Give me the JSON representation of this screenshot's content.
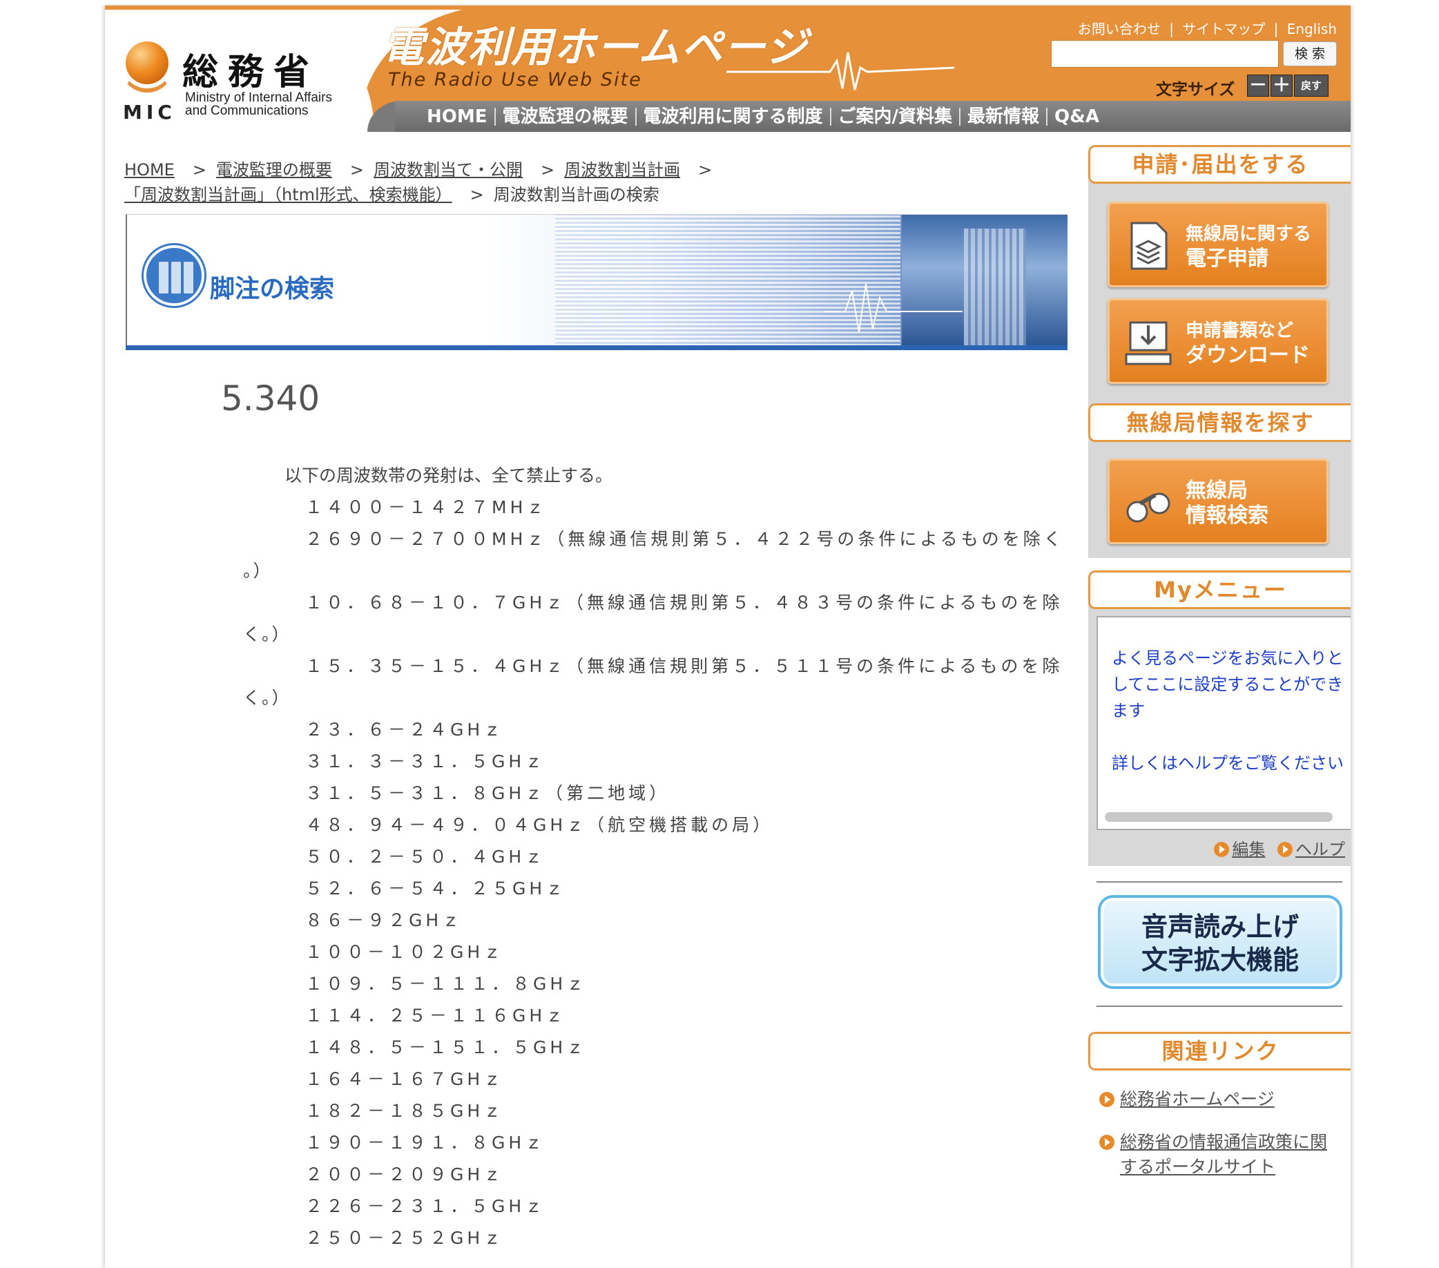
{
  "header": {
    "ministry_kanji": "総務省",
    "mic": "MIC",
    "ministry_en_1": "Ministry of Internal Affairs",
    "ministry_en_2": "and Communications",
    "site_title": "電波利用ホームページ",
    "site_subtitle": "The Radio Use Web Site",
    "toplinks": [
      "お問い合わせ",
      "|",
      "サイトマップ",
      "|",
      "English"
    ],
    "search_placeholder": "",
    "search_button": "検 索",
    "fontsize_label": "文字サイズ",
    "fontsize_minus": "－",
    "fontsize_plus": "＋",
    "fontsize_reset": "戻す",
    "colors": {
      "orange": "#e6903a",
      "nav_gray": "#7a7a7a"
    }
  },
  "nav": {
    "items": [
      "HOME",
      "電波監理の概要",
      "電波利用に関する制度",
      "ご案内/資料集",
      "最新情報",
      "Q&A"
    ]
  },
  "breadcrumb": {
    "items": [
      "HOME",
      "電波監理の概要",
      "周波数割当て・公開",
      "周波数割当計画",
      "「周波数割当計画」（html形式、検索機能）"
    ],
    "current": "周波数割当計画の検索",
    "separator": ">"
  },
  "banner": {
    "title": "脚注の検索"
  },
  "footnote": {
    "number": "5.340",
    "intro": "以下の周波数帯の発射は、全て禁止する。",
    "lines": [
      {
        "text": "１４００－１４２７MHｚ"
      },
      {
        "text": "２６９０－２７００MHｚ（無線通信規則第５．４２２号の条件によるものを除く",
        "wrap": "。）"
      },
      {
        "text": "１０．６８－１０．７GHｚ（無線通信規則第５．４８３号の条件によるものを除",
        "wrap": "く。）"
      },
      {
        "text": "１５．３５－１５．４GHｚ（無線通信規則第５．５１１号の条件によるものを除",
        "wrap": "く。）"
      },
      {
        "text": "２３．６－２４GHｚ"
      },
      {
        "text": "３１．３－３１．５GHｚ"
      },
      {
        "text": "３１．５－３１．８GHｚ（第二地域）"
      },
      {
        "text": "４８．９４－４９．０４GHｚ（航空機搭載の局）"
      },
      {
        "text": "５０．２－５０．４GHｚ"
      },
      {
        "text": "５２．６－５４．２５GHｚ"
      },
      {
        "text": "８６－９２GHｚ"
      },
      {
        "text": "１００－１０２GHｚ"
      },
      {
        "text": "１０９．５－１１１．８GHｚ"
      },
      {
        "text": "１１４．２５－１１６GHｚ"
      },
      {
        "text": "１４８．５－１５１．５GHｚ"
      },
      {
        "text": "１６４－１６７GHｚ"
      },
      {
        "text": "１８２－１８５GHｚ"
      },
      {
        "text": "１９０－１９１．８GHｚ"
      },
      {
        "text": "２００－２０９GHｚ"
      },
      {
        "text": "２２６－２３１．５GHｚ"
      },
      {
        "text": "２５０－２５２GHｚ"
      }
    ]
  },
  "sidebar": {
    "apply_head": "申請･届出をする",
    "btn_eapply_1": "無線局に関する",
    "btn_eapply_2": "電子申請",
    "btn_download_1": "申請書類など",
    "btn_download_2": "ダウンロード",
    "search_head": "無線局情報を探す",
    "btn_search_1": "無線局",
    "btn_search_2": "情報検索",
    "mymenu_head": "Myメニュー",
    "mymenu_text_1": "よく見るページをお気に入りとしてここに設定することができます",
    "mymenu_text_2": "詳しくはヘルプをご覧ください",
    "mymenu_edit": "編集",
    "mymenu_help": "ヘルプ",
    "voice_1": "音声読み上げ",
    "voice_2": "文字拡大機能",
    "links_head": "関連リンク",
    "link_1": "総務省ホームページ",
    "link_2a": "総務省の情報通信政策に関",
    "link_2b": "するポータルサイト"
  }
}
